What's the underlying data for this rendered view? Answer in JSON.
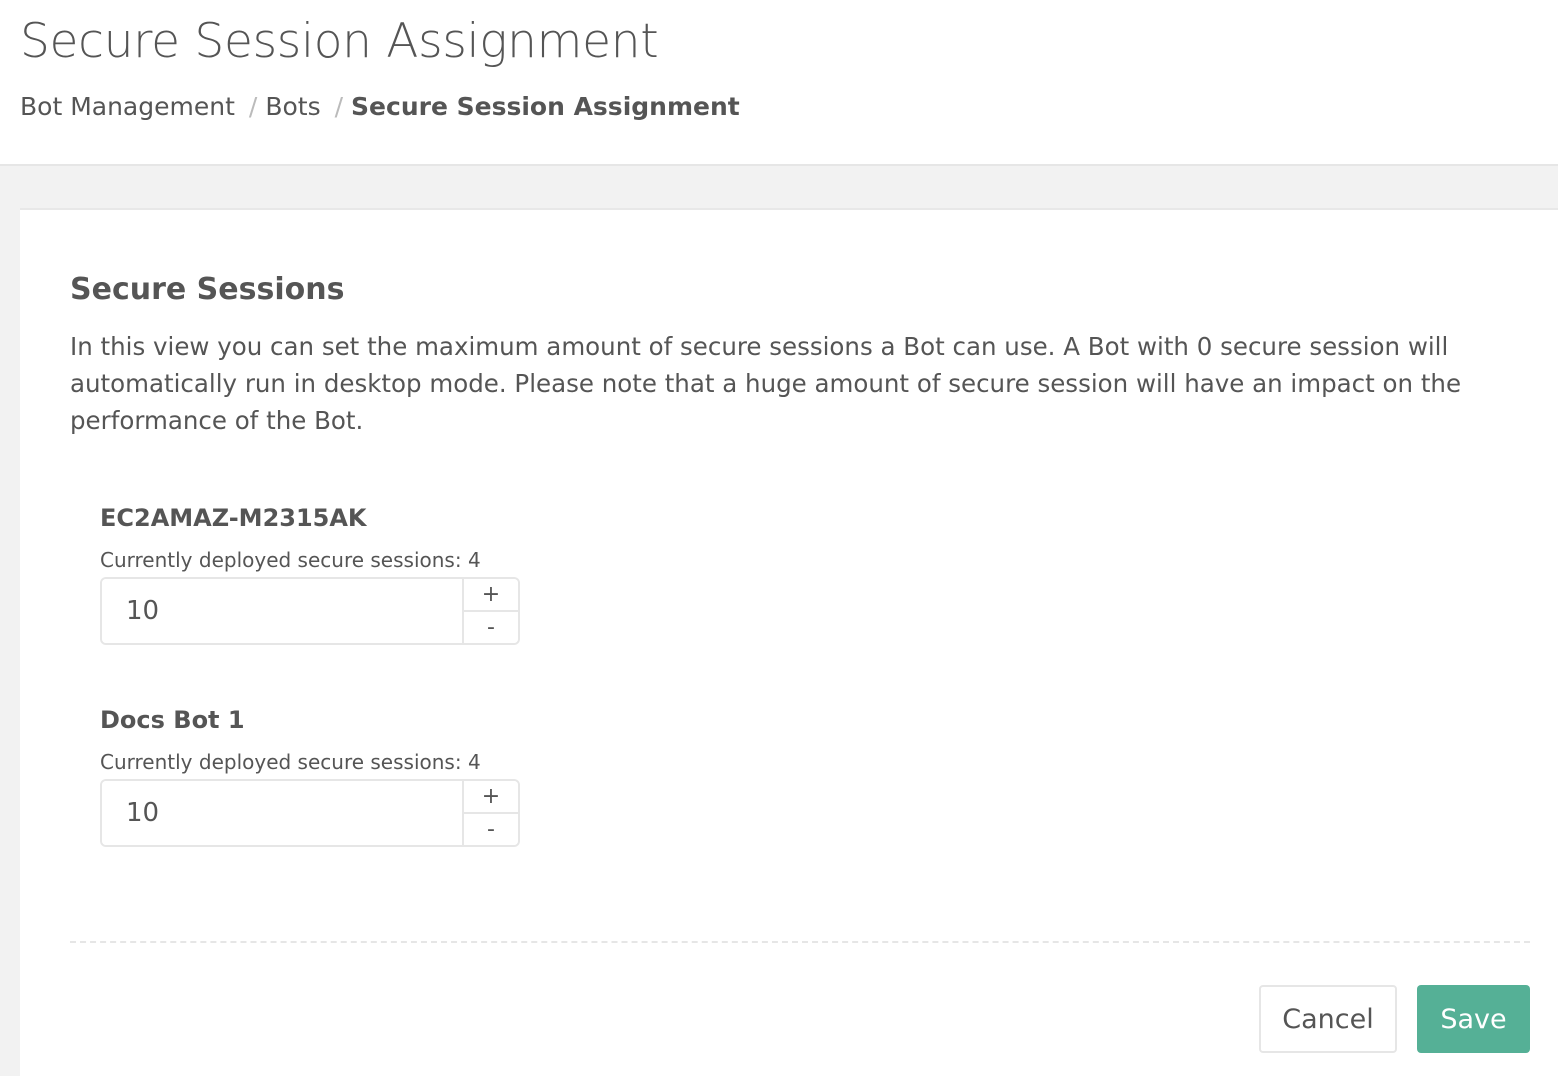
{
  "header": {
    "title": "Secure Session Assignment",
    "breadcrumb": [
      {
        "label": "Bot Management"
      },
      {
        "label": "Bots"
      },
      {
        "label": "Secure Session Assignment"
      }
    ],
    "separator": "/"
  },
  "section": {
    "title": "Secure Sessions",
    "description": "In this view you can set the maximum amount of secure sessions a Bot can use. A Bot with 0 secure session will automatically run in desktop mode. Please note that a huge amount of secure session will have an impact on the performance of the Bot."
  },
  "bots": [
    {
      "name": "EC2AMAZ-M2315AK",
      "deployed_label": "Currently deployed secure sessions: 4",
      "value": "10",
      "increment_label": "+",
      "decrement_label": "-"
    },
    {
      "name": "Docs Bot 1",
      "deployed_label": "Currently deployed secure sessions: 4",
      "value": "10",
      "increment_label": "+",
      "decrement_label": "-"
    }
  ],
  "actions": {
    "cancel_label": "Cancel",
    "save_label": "Save"
  },
  "colors": {
    "primary": "#55b096",
    "text": "#555555",
    "background": "#f2f2f2"
  }
}
